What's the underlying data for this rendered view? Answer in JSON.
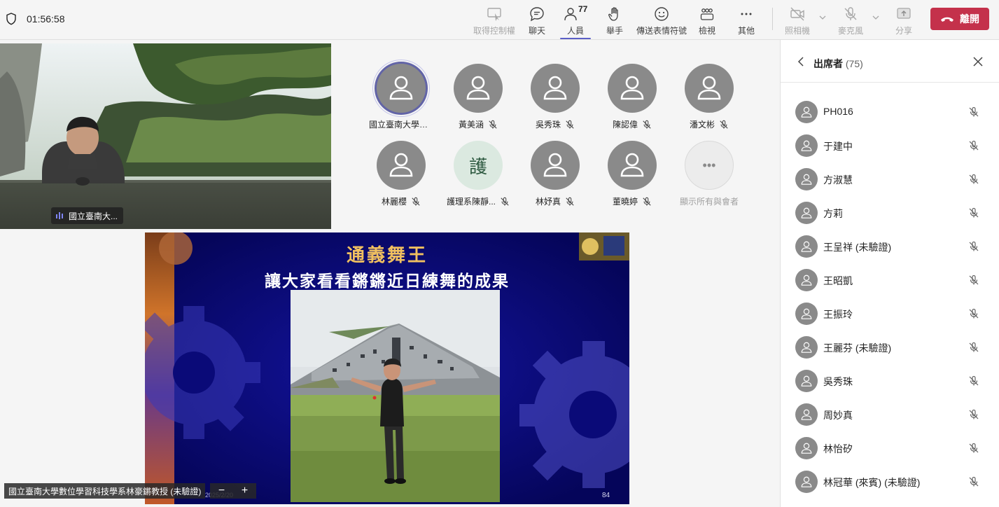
{
  "meeting": {
    "timer": "01:56:58"
  },
  "toolbar": {
    "share_control": "取得控制權",
    "chat": "聊天",
    "people": "人員",
    "people_count": "77",
    "raise_hand": "舉手",
    "reactions": "傳送表情符號",
    "view": "檢視",
    "more": "其他",
    "camera": "照相機",
    "mic": "麥克風",
    "share": "分享",
    "leave": "離開"
  },
  "video": {
    "name": "國立臺南大..."
  },
  "grid": {
    "tiles": [
      {
        "name": "國立臺南大學數...",
        "muted": false,
        "speaking": true
      },
      {
        "name": "黃美涵",
        "muted": true
      },
      {
        "name": "吳秀珠",
        "muted": true
      },
      {
        "name": "陳認偉",
        "muted": true
      },
      {
        "name": "潘文彬",
        "muted": true
      },
      {
        "name": "林麗櫻",
        "muted": true
      },
      {
        "name": "護理系陳靜...",
        "muted": true,
        "initial": "護"
      },
      {
        "name": "林妤真",
        "muted": true
      },
      {
        "name": "董曉婷",
        "muted": true
      },
      {
        "name": "顯示所有與會者",
        "more": true
      }
    ]
  },
  "slide": {
    "title": "通義舞王",
    "subtitle": "讓大家看看鏘鏘近日練舞的成果",
    "date": "2025/2/20",
    "page": "84",
    "presenter": "國立臺南大學數位學習科技學系林豪鏘教授 (未驗證)"
  },
  "panel": {
    "title": "出席者",
    "count": "(75)",
    "attendees": [
      "PH016",
      "于建中",
      "方淑慧",
      "方莉",
      "王呈祥 (未驗證)",
      "王昭凱",
      "王振玲",
      "王麗芬 (未驗證)",
      "吳秀珠",
      "周妙真",
      "林怡矽",
      "林冠華 (來賓) (未驗證)"
    ]
  },
  "colors": {
    "accent": "#5b5fc7",
    "leave": "#c4314b",
    "slide_bg": "#0a0a78",
    "slide_title": "#f0c060"
  }
}
